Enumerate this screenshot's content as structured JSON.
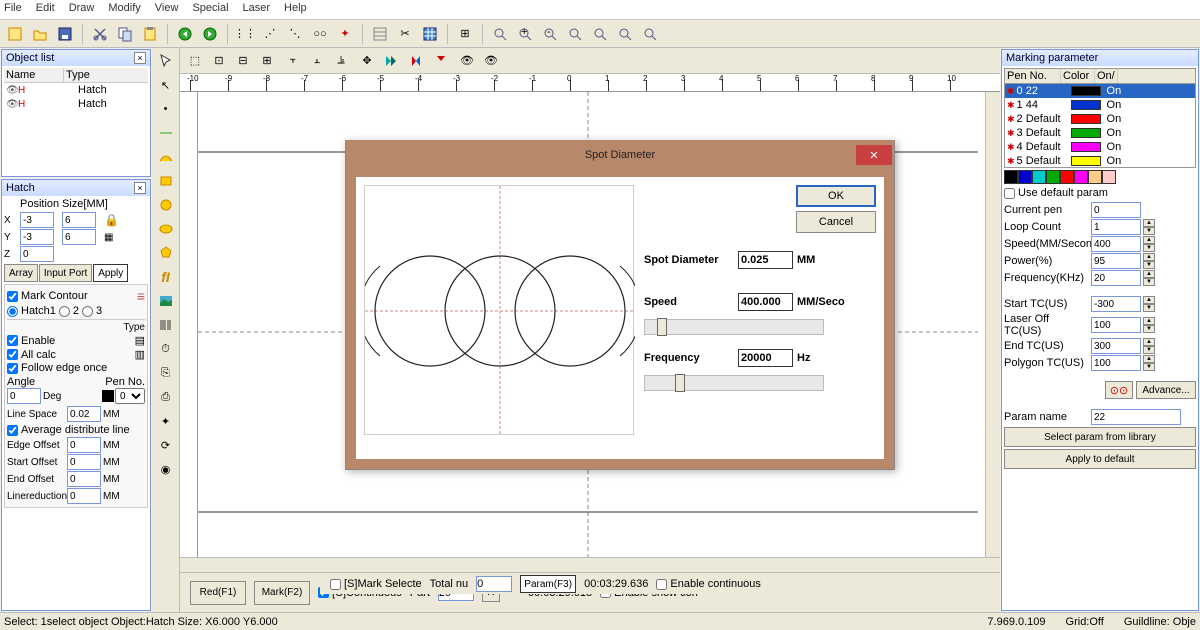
{
  "menu": [
    "File",
    "Edit",
    "Draw",
    "Modify",
    "View",
    "Special",
    "Laser",
    "Help"
  ],
  "objectList": {
    "title": "Object list",
    "cols": [
      "Name",
      "Type"
    ],
    "rows": [
      {
        "name": "",
        "type": "Hatch"
      },
      {
        "name": "",
        "type": "Hatch"
      }
    ]
  },
  "hatch": {
    "title": "Hatch",
    "posLabel": "Position",
    "sizeLabel": "Size[MM]",
    "x": "-3",
    "y": "-3",
    "z": "0",
    "sx": "6",
    "sy": "6",
    "array": "Array",
    "inputPort": "Input Port",
    "apply": "Apply",
    "markContour": "Mark Contour",
    "h1": "Hatch1",
    "h2": "2",
    "h3": "3",
    "enable": "Enable",
    "allcalc": "All calc",
    "follow": "Follow edge once",
    "typeLbl": "Type",
    "angle": "Angle",
    "angleVal": "0",
    "deg": "Deg",
    "penno": "Pen No.",
    "penval": "0",
    "lineSpace": "Line Space",
    "lineSpaceVal": "0.02",
    "mm": "MM",
    "avg": "Average distribute line",
    "edgeOffset": "Edge Offset",
    "edgeOffsetVal": "0",
    "startOffset": "Start Offset",
    "startOffsetVal": "0",
    "endOffset": "End Offset",
    "endOffsetVal": "0",
    "linered": "Linereduction",
    "lineredVal": "0"
  },
  "dialog": {
    "title": "Spot Diameter",
    "ok": "OK",
    "cancel": "Cancel",
    "spot": "Spot Diameter",
    "spotVal": "0.025",
    "mm": "MM",
    "speed": "Speed",
    "speedVal": "400.000",
    "speedUnit": "MM/Seco",
    "freq": "Frequency",
    "freqVal": "20000",
    "hz": "Hz"
  },
  "marking": {
    "title": "Marking parameter",
    "hdr": [
      "Pen No.",
      "Color",
      "On/"
    ],
    "pens": [
      {
        "n": "0 22",
        "c": "#000",
        "on": "On",
        "sel": true
      },
      {
        "n": "1 44",
        "c": "#0033cc",
        "on": "On"
      },
      {
        "n": "2 Default",
        "c": "#f00",
        "on": "On"
      },
      {
        "n": "3 Default",
        "c": "#0a0",
        "on": "On"
      },
      {
        "n": "4 Default",
        "c": "#f0f",
        "on": "On"
      },
      {
        "n": "5 Default",
        "c": "#ff0",
        "on": "On"
      }
    ],
    "colors": [
      "#000",
      "#00c",
      "#0cc",
      "#0a0",
      "#f00",
      "#f0f",
      "#fc8",
      "#fcc"
    ],
    "useDefault": "Use default param",
    "params": [
      {
        "l": "Current pen",
        "v": "0",
        "sp": false
      },
      {
        "l": "Loop Count",
        "v": "1",
        "sp": true
      },
      {
        "l": "Speed(MM/Second",
        "v": "400",
        "sp": true
      },
      {
        "l": "Power(%)",
        "v": "95",
        "sp": true
      },
      {
        "l": "Frequency(KHz)",
        "v": "20",
        "sp": true
      }
    ],
    "params2": [
      {
        "l": "Start TC(US)",
        "v": "-300",
        "sp": true
      },
      {
        "l": "Laser Off TC(US)",
        "v": "100",
        "sp": true
      },
      {
        "l": "End TC(US)",
        "v": "300",
        "sp": true
      },
      {
        "l": "Polygon TC(US)",
        "v": "100",
        "sp": true
      }
    ],
    "advance": "Advance...",
    "paramName": "Param name",
    "paramNameVal": "22",
    "selectParam": "Select param from library",
    "applyDefault": "Apply to default"
  },
  "bottomBar": {
    "red": "Red(F1)",
    "mark": "Mark(F2)",
    "continuous": "[C]Continuous",
    "markSel": "[S]Mark Selecte",
    "part": "Part",
    "partVal": "29",
    "r": "R",
    "total": "Total nu",
    "totalVal": "0",
    "time1": "00:03:29.618",
    "time2": "00:03:29.636",
    "param": "Param(F3)",
    "showCon": "Enable show con",
    "enableCont": "Enable continuous"
  },
  "status": {
    "left": "Select: 1select object Object:Hatch Size: X6.000 Y6.000",
    "ver": "7.969.0.109",
    "grid": "Grid:Off",
    "guide": "Guildline: Obje"
  }
}
